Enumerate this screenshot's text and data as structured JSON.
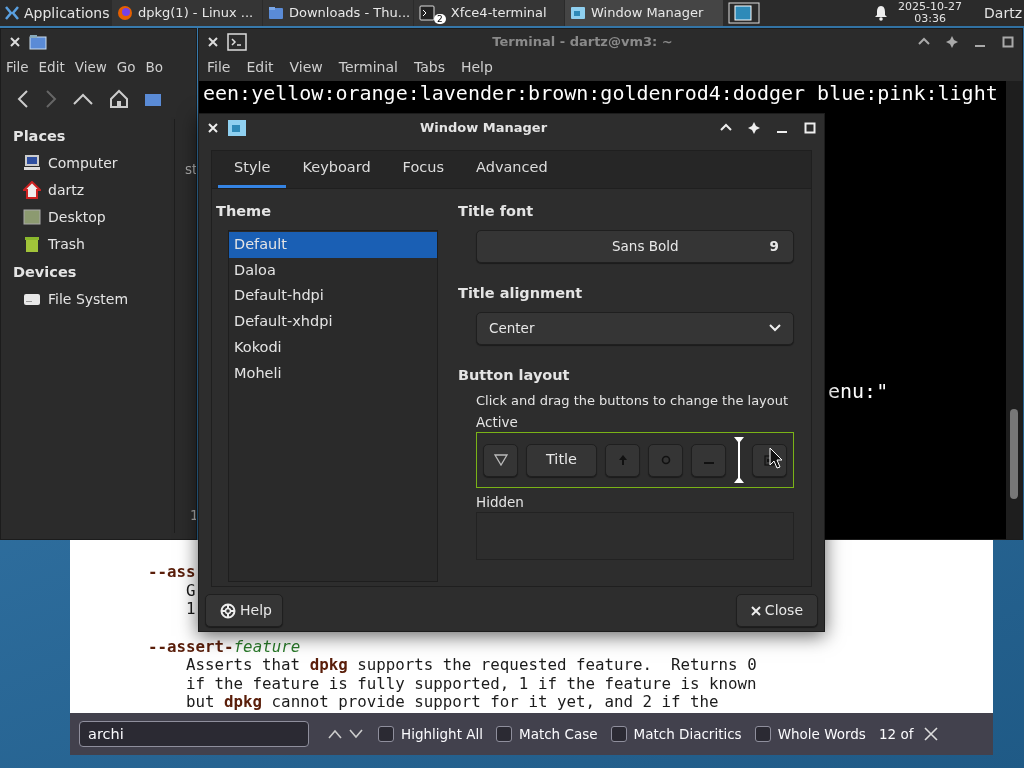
{
  "taskbar": {
    "applications": "Applications",
    "tasks": [
      {
        "label": "dpkg(1) - Linux ...",
        "kind": "browser",
        "selected": false
      },
      {
        "label": "Downloads - Thu...",
        "kind": "folder",
        "selected": false
      },
      {
        "label": "Xfce4-terminal",
        "kind": "terminal",
        "selected": false,
        "badge": "2"
      },
      {
        "label": "Window Manager",
        "kind": "wm",
        "selected": true
      }
    ],
    "date": "2025-10-27",
    "time": "03:36",
    "user": "Dartz"
  },
  "file_manager": {
    "menus": [
      "File",
      "Edit",
      "View",
      "Go",
      "Bo"
    ],
    "sidebar": [
      {
        "heading": "Places",
        "items": [
          {
            "label": "Computer",
            "kind": "computer"
          },
          {
            "label": "dartz",
            "kind": "home"
          },
          {
            "label": "Desktop",
            "kind": "desktop"
          },
          {
            "label": "Trash",
            "kind": "trash"
          }
        ]
      },
      {
        "heading": "Devices",
        "items": [
          {
            "label": "File System",
            "kind": "drive"
          }
        ]
      }
    ],
    "pane_text": "st",
    "status_text": "1"
  },
  "terminal": {
    "title": "Terminal - dartz@vm3: ~",
    "menus": [
      "File",
      "Edit",
      "View",
      "Terminal",
      "Tabs",
      "Help"
    ],
    "line_1": "een:yellow:orange:lavender:brown:goldenrod4:dodger blue:pink:light",
    "line_2": "enu:\""
  },
  "man_page": {
    "lines": [
      {
        "kind": "option",
        "option": "--ass"
      },
      {
        "kind": "text",
        "text": "G"
      },
      {
        "kind": "text",
        "text": "1"
      },
      {
        "kind": "gap"
      },
      {
        "kind": "option",
        "option": "--assert-",
        "argument": "feature"
      },
      {
        "kind": "text",
        "text": "Asserts that **dpkg** supports the requested feature.  Returns 0"
      },
      {
        "kind": "text",
        "text": "if the feature is fully supported, 1 if the feature is known"
      },
      {
        "kind": "text",
        "text": "but **dpkg** cannot provide support for it yet, and 2 if the"
      }
    ]
  },
  "find_bar": {
    "value": "archi",
    "options": [
      {
        "label": "Highlight All",
        "checked": false
      },
      {
        "label": "Match Case",
        "checked": false
      },
      {
        "label": "Match Diacritics",
        "checked": false
      },
      {
        "label": "Whole Words",
        "checked": false
      }
    ],
    "result": "12 of"
  },
  "dialog": {
    "title": "Window Manager",
    "tabs": [
      {
        "label": "Style",
        "selected": true
      },
      {
        "label": "Keyboard",
        "selected": false
      },
      {
        "label": "Focus",
        "selected": false
      },
      {
        "label": "Advanced",
        "selected": false
      }
    ],
    "theme_label": "Theme",
    "themes": [
      {
        "label": "Default",
        "selected": true
      },
      {
        "label": "Daloa",
        "selected": false
      },
      {
        "label": "Default-hdpi",
        "selected": false
      },
      {
        "label": "Default-xhdpi",
        "selected": false
      },
      {
        "label": "Kokodi",
        "selected": false
      },
      {
        "label": "Moheli",
        "selected": false
      }
    ],
    "title_font_label": "Title font",
    "font_name": "Sans Bold",
    "font_size": "9",
    "alignment_label": "Title alignment",
    "alignment": "Center",
    "layout_label": "Button layout",
    "layout_hint": "Click and drag the buttons to change the layout",
    "active_label": "Active",
    "active_buttons": [
      {
        "kind": "menu"
      },
      {
        "kind": "title",
        "label": "Title"
      },
      {
        "kind": "shade"
      },
      {
        "kind": "stick"
      },
      {
        "kind": "minimize"
      },
      {
        "kind": "insert"
      },
      {
        "kind": "maximize"
      }
    ],
    "hidden_label": "Hidden",
    "help": "Help",
    "close": "Close"
  }
}
